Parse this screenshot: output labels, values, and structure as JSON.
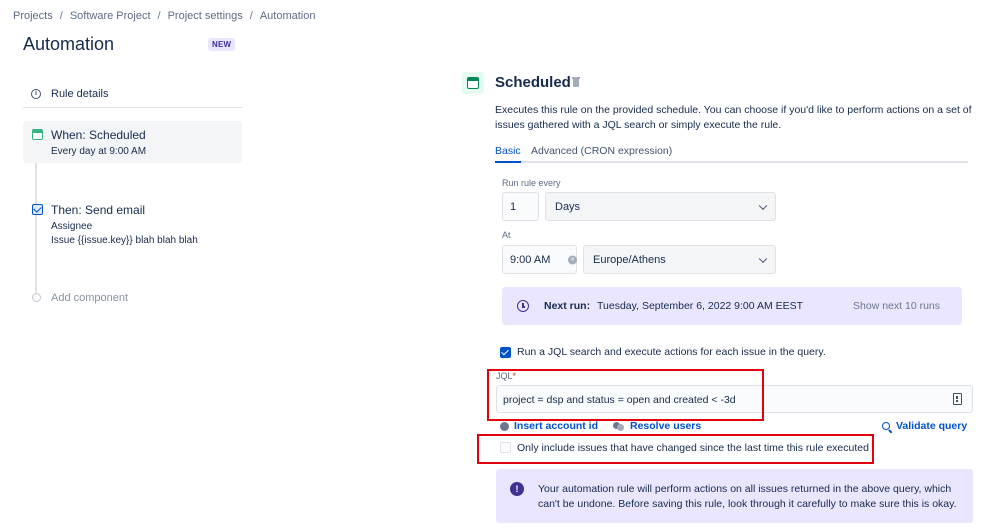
{
  "breadcrumb": [
    "Projects",
    "Software Project",
    "Project settings",
    "Automation"
  ],
  "page": {
    "title": "Automation",
    "badge": "NEW"
  },
  "rule_panel": {
    "details_label": "Rule details",
    "when": {
      "title": "When: Scheduled",
      "sub": "Every day at 9:00 AM"
    },
    "then": {
      "title": "Then: Send email",
      "sub1": "Assignee",
      "sub2": "Issue {{issue.key}} blah blah blah"
    },
    "add_component": "Add component"
  },
  "scheduled": {
    "title": "Scheduled",
    "description": "Executes this rule on the provided schedule. You can choose if you'd like to perform actions on a set of issues gathered with a JQL search or simply execute the rule.",
    "tabs": [
      "Basic",
      "Advanced (CRON expression)"
    ],
    "run_every_label": "Run rule every",
    "run_every_value": "1",
    "run_every_unit": "Days",
    "at_label": "At",
    "at_time": "9:00 AM",
    "timezone": "Europe/Athens",
    "next_run_label": "Next run:",
    "next_run_value": "Tuesday, September 6, 2022 9:00 AM EEST",
    "show_next": "Show next 10 runs",
    "jql_check_label": "Run a JQL search and execute actions for each issue in the query.",
    "jql_label": "JQL",
    "jql_required": "*",
    "jql_value": "project = dsp and status = open and created < -3d",
    "insert_account": "Insert account id",
    "resolve_users": "Resolve users",
    "validate_query": "Validate query",
    "only_changed_label": "Only include issues that have changed since the last time this rule executed",
    "warning_text": "Your automation rule will perform actions on all issues returned in the above query, which can't be undone. Before saving this rule, look through it carefully to make sure this is okay."
  },
  "colors": {
    "accent": "#0052cc",
    "purple_bg": "#eae6ff",
    "highlight": "#e3000f",
    "schedule_green": "#00875a"
  },
  "icons": [
    "info-icon",
    "calendar-icon",
    "mail-icon",
    "trash-icon",
    "chevron-down-icon",
    "clear-icon",
    "clock-icon",
    "user-icon",
    "users-icon",
    "search-icon",
    "document-icon",
    "warning-icon"
  ]
}
